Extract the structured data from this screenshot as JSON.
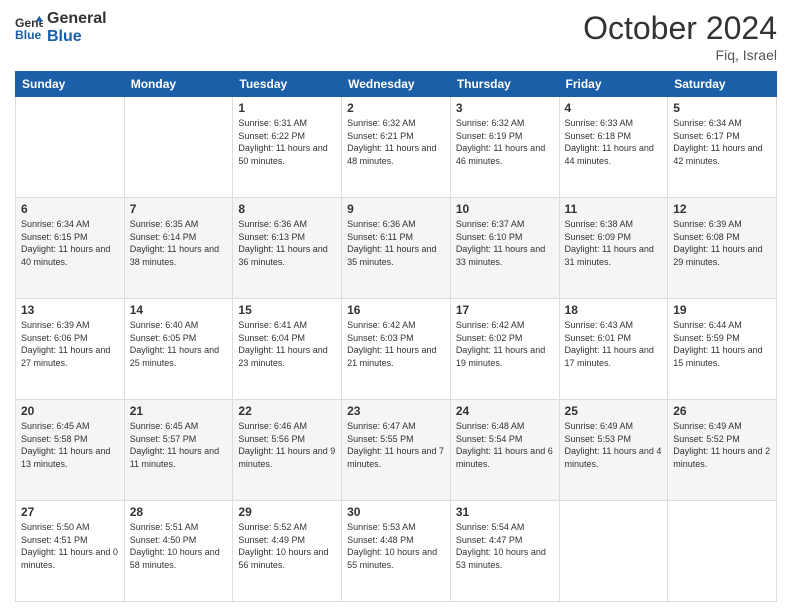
{
  "header": {
    "logo": {
      "line1": "General",
      "line2": "Blue"
    },
    "title": "October 2024",
    "location": "Fiq, Israel"
  },
  "weekdays": [
    "Sunday",
    "Monday",
    "Tuesday",
    "Wednesday",
    "Thursday",
    "Friday",
    "Saturday"
  ],
  "weeks": [
    [
      null,
      null,
      {
        "day": 1,
        "sunrise": "6:31 AM",
        "sunset": "6:22 PM",
        "daylight": "11 hours and 50 minutes."
      },
      {
        "day": 2,
        "sunrise": "6:32 AM",
        "sunset": "6:21 PM",
        "daylight": "11 hours and 48 minutes."
      },
      {
        "day": 3,
        "sunrise": "6:32 AM",
        "sunset": "6:19 PM",
        "daylight": "11 hours and 46 minutes."
      },
      {
        "day": 4,
        "sunrise": "6:33 AM",
        "sunset": "6:18 PM",
        "daylight": "11 hours and 44 minutes."
      },
      {
        "day": 5,
        "sunrise": "6:34 AM",
        "sunset": "6:17 PM",
        "daylight": "11 hours and 42 minutes."
      }
    ],
    [
      {
        "day": 6,
        "sunrise": "6:34 AM",
        "sunset": "6:15 PM",
        "daylight": "11 hours and 40 minutes."
      },
      {
        "day": 7,
        "sunrise": "6:35 AM",
        "sunset": "6:14 PM",
        "daylight": "11 hours and 38 minutes."
      },
      {
        "day": 8,
        "sunrise": "6:36 AM",
        "sunset": "6:13 PM",
        "daylight": "11 hours and 36 minutes."
      },
      {
        "day": 9,
        "sunrise": "6:36 AM",
        "sunset": "6:11 PM",
        "daylight": "11 hours and 35 minutes."
      },
      {
        "day": 10,
        "sunrise": "6:37 AM",
        "sunset": "6:10 PM",
        "daylight": "11 hours and 33 minutes."
      },
      {
        "day": 11,
        "sunrise": "6:38 AM",
        "sunset": "6:09 PM",
        "daylight": "11 hours and 31 minutes."
      },
      {
        "day": 12,
        "sunrise": "6:39 AM",
        "sunset": "6:08 PM",
        "daylight": "11 hours and 29 minutes."
      }
    ],
    [
      {
        "day": 13,
        "sunrise": "6:39 AM",
        "sunset": "6:06 PM",
        "daylight": "11 hours and 27 minutes."
      },
      {
        "day": 14,
        "sunrise": "6:40 AM",
        "sunset": "6:05 PM",
        "daylight": "11 hours and 25 minutes."
      },
      {
        "day": 15,
        "sunrise": "6:41 AM",
        "sunset": "6:04 PM",
        "daylight": "11 hours and 23 minutes."
      },
      {
        "day": 16,
        "sunrise": "6:42 AM",
        "sunset": "6:03 PM",
        "daylight": "11 hours and 21 minutes."
      },
      {
        "day": 17,
        "sunrise": "6:42 AM",
        "sunset": "6:02 PM",
        "daylight": "11 hours and 19 minutes."
      },
      {
        "day": 18,
        "sunrise": "6:43 AM",
        "sunset": "6:01 PM",
        "daylight": "11 hours and 17 minutes."
      },
      {
        "day": 19,
        "sunrise": "6:44 AM",
        "sunset": "5:59 PM",
        "daylight": "11 hours and 15 minutes."
      }
    ],
    [
      {
        "day": 20,
        "sunrise": "6:45 AM",
        "sunset": "5:58 PM",
        "daylight": "11 hours and 13 minutes."
      },
      {
        "day": 21,
        "sunrise": "6:45 AM",
        "sunset": "5:57 PM",
        "daylight": "11 hours and 11 minutes."
      },
      {
        "day": 22,
        "sunrise": "6:46 AM",
        "sunset": "5:56 PM",
        "daylight": "11 hours and 9 minutes."
      },
      {
        "day": 23,
        "sunrise": "6:47 AM",
        "sunset": "5:55 PM",
        "daylight": "11 hours and 7 minutes."
      },
      {
        "day": 24,
        "sunrise": "6:48 AM",
        "sunset": "5:54 PM",
        "daylight": "11 hours and 6 minutes."
      },
      {
        "day": 25,
        "sunrise": "6:49 AM",
        "sunset": "5:53 PM",
        "daylight": "11 hours and 4 minutes."
      },
      {
        "day": 26,
        "sunrise": "6:49 AM",
        "sunset": "5:52 PM",
        "daylight": "11 hours and 2 minutes."
      }
    ],
    [
      {
        "day": 27,
        "sunrise": "5:50 AM",
        "sunset": "4:51 PM",
        "daylight": "11 hours and 0 minutes."
      },
      {
        "day": 28,
        "sunrise": "5:51 AM",
        "sunset": "4:50 PM",
        "daylight": "10 hours and 58 minutes."
      },
      {
        "day": 29,
        "sunrise": "5:52 AM",
        "sunset": "4:49 PM",
        "daylight": "10 hours and 56 minutes."
      },
      {
        "day": 30,
        "sunrise": "5:53 AM",
        "sunset": "4:48 PM",
        "daylight": "10 hours and 55 minutes."
      },
      {
        "day": 31,
        "sunrise": "5:54 AM",
        "sunset": "4:47 PM",
        "daylight": "10 hours and 53 minutes."
      },
      null,
      null
    ]
  ]
}
